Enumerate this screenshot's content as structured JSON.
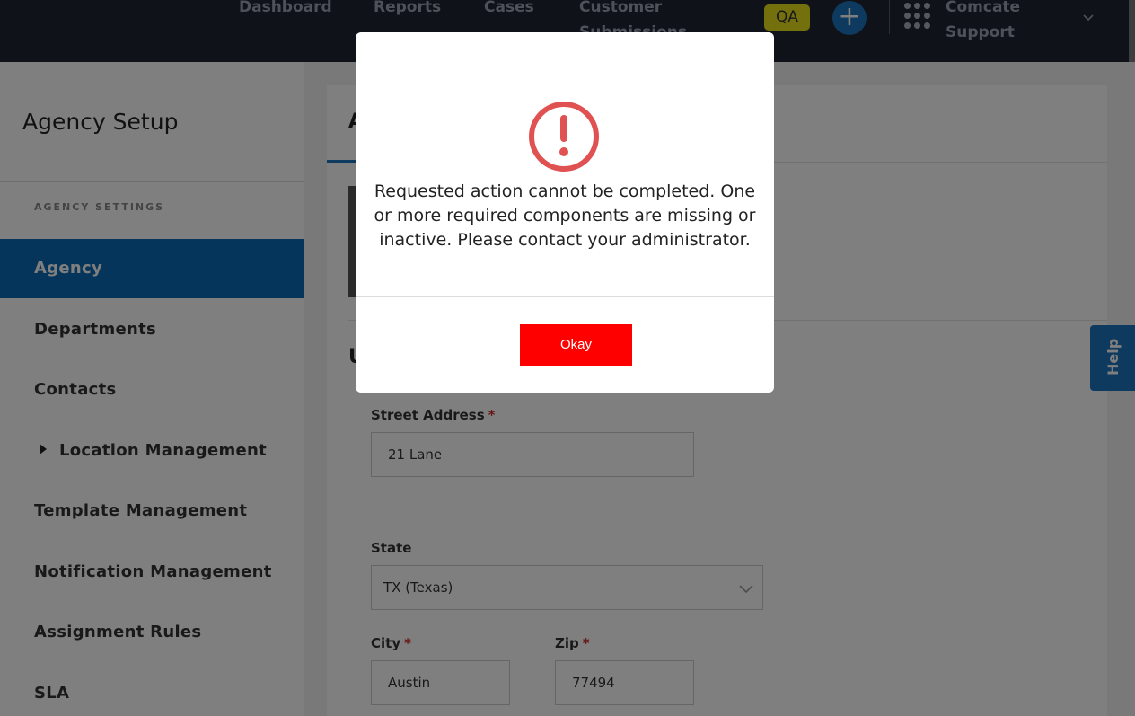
{
  "nav": {
    "links": [
      "Dashboard",
      "Reports",
      "Cases",
      "Customer Submissions"
    ],
    "env_badge": "QA",
    "add_icon": "plus-icon",
    "apps_icon": "grid-icon",
    "org_name": "Comcate Support",
    "chevron_icon": "chevron-down-icon"
  },
  "sidebar": {
    "title": "Agency Setup",
    "section_label": "AGENCY SETTINGS",
    "items": [
      {
        "label": "Agency",
        "active": true
      },
      {
        "label": "Departments"
      },
      {
        "label": "Contacts"
      },
      {
        "label": "Location Management",
        "expandable": true
      },
      {
        "label": "Template Management"
      },
      {
        "label": "Notification Management"
      },
      {
        "label": "Assignment Rules"
      },
      {
        "label": "SLA"
      }
    ]
  },
  "main": {
    "tab_visible_char": "A",
    "section_visible_char": "U",
    "form": {
      "street_label": "Street Address",
      "street_value": "21 Lane",
      "state_label": "State",
      "state_value": "TX (Texas)",
      "city_label": "City",
      "city_value": "Austin",
      "zip_label": "Zip",
      "zip_value": "77494",
      "required_marker": "*"
    }
  },
  "help": {
    "label": "Help"
  },
  "modal": {
    "icon": "alert-exclamation-icon",
    "message": "Requested action cannot be completed. One or more required components are missing or inactive. Please contact your administrator.",
    "okay_label": "Okay"
  },
  "colors": {
    "topbar": "#1f2430",
    "active_nav": "#0a6bb5",
    "qa_badge": "#e8e01a",
    "accent": "#1b75bc",
    "alert_red": "#e05252",
    "okay_button": "#ff0000"
  }
}
